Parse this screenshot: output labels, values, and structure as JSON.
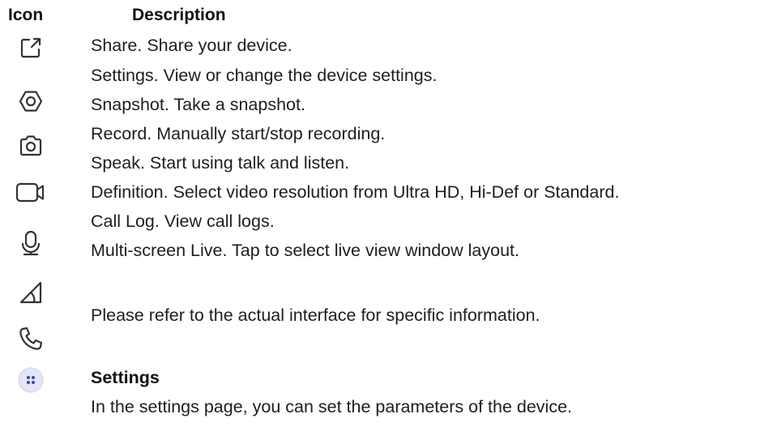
{
  "header": {
    "icon_label": "Icon",
    "description_label": "Description"
  },
  "descriptions": [
    "Share. Share your device.",
    "Settings. View or change the device settings.",
    "Snapshot. Take a snapshot.",
    "Record. Manually start/stop recording.",
    "Speak. Start using talk and listen.",
    "Definition. Select video resolution from Ultra HD, Hi-Def or Standard.",
    "Call Log. View call logs.",
    "Multi-screen Live. Tap to select live view window layout."
  ],
  "note": "Please refer to the actual interface for specific information.",
  "icons": [
    "share-icon",
    "settings-hexagon-icon",
    "camera-icon",
    "video-camera-icon",
    "microphone-icon",
    "signal-triangle-icon",
    "phone-icon",
    "grid-dots-icon"
  ],
  "settings": {
    "title": "Settings",
    "description": "In the settings page, you can set the parameters of the device."
  },
  "colors": {
    "icon_stroke": "#333333",
    "settings_icon_fill": "#e3e6f5",
    "settings_icon_dots": "#3d4b9c"
  }
}
